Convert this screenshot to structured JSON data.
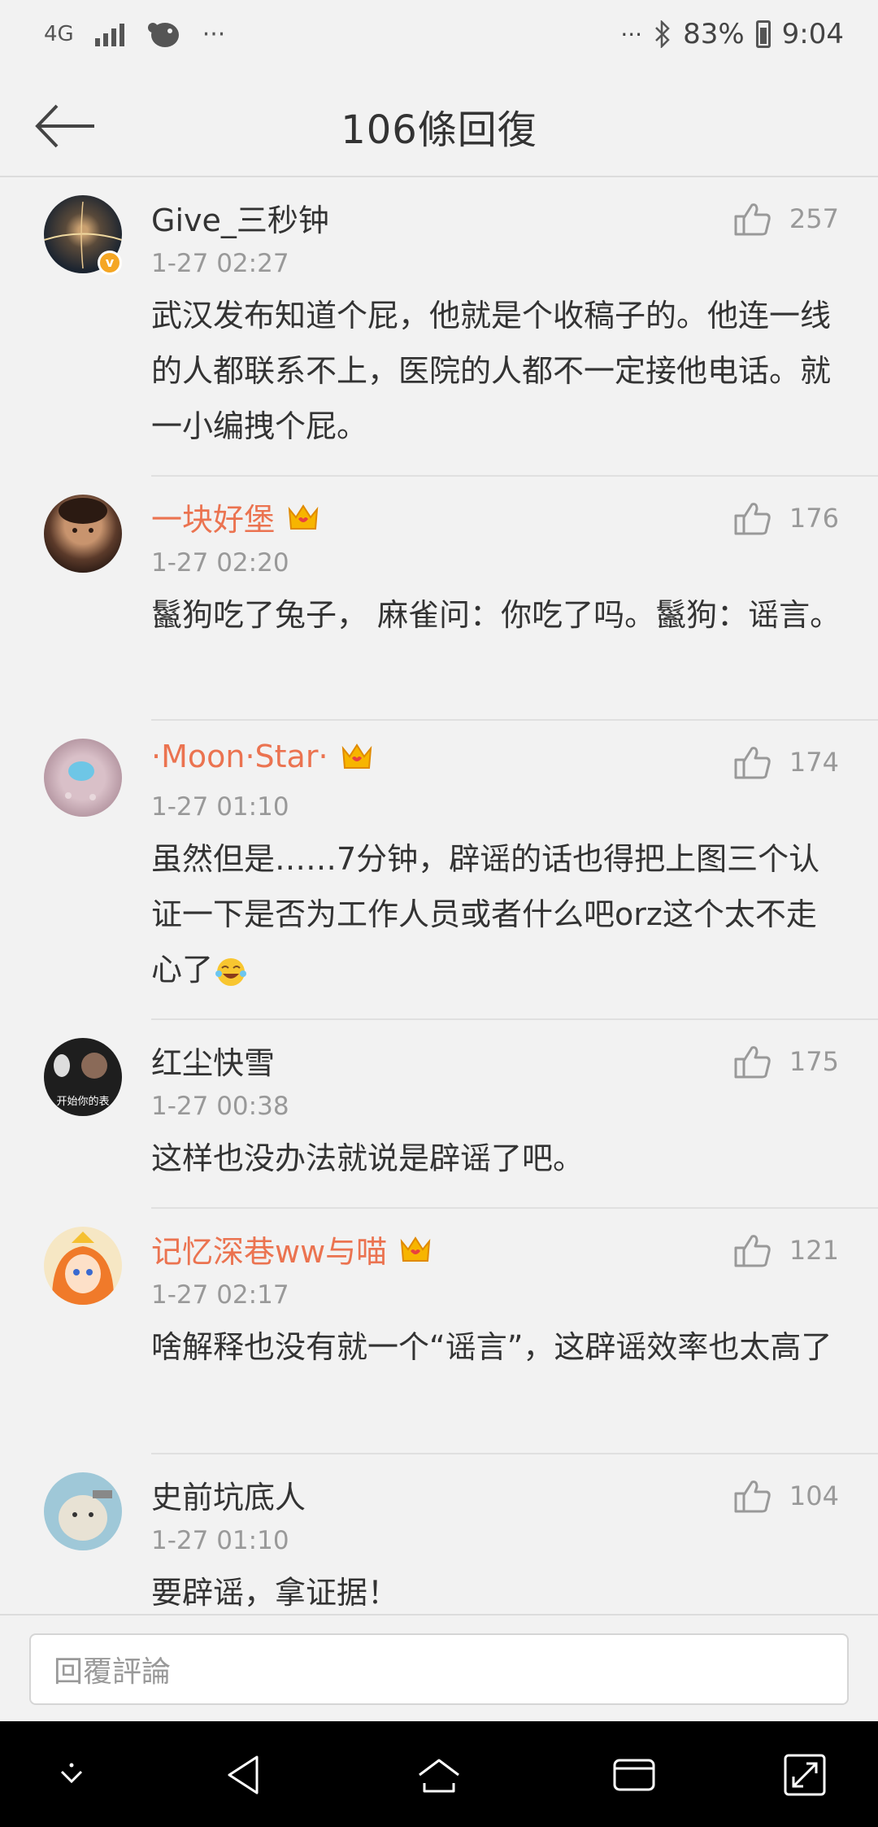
{
  "status_bar": {
    "network": "4G",
    "dots_left": "···",
    "dots_right": "···",
    "battery": "83%",
    "time": "9:04"
  },
  "header": {
    "title": "106條回復",
    "back_icon": "arrow-left-icon"
  },
  "comments": [
    {
      "username": "Give_三秒钟",
      "time": "1-27 02:27",
      "text": "武汉发布知道个屁，他就是个收稿子的。他连一线的人都联系不上，医院的人都不一定接他电话。就一小编拽个屁。",
      "likes": "257",
      "vip": false,
      "verified": true
    },
    {
      "username": "一块好堡",
      "time": "1-27 02:20",
      "text": "鬣狗吃了兔子， 麻雀问：你吃了吗。鬣狗：谣言。",
      "likes": "176",
      "vip": true,
      "verified": false
    },
    {
      "username": "·Moon·Star·",
      "time": "1-27 01:10",
      "text": "虽然但是……7分钟，辟谣的话也得把上图三个认证一下是否为工作人员或者什么吧orz这个太不走心了",
      "likes": "174",
      "vip": true,
      "verified": false
    },
    {
      "username": "红尘快雪",
      "time": "1-27 00:38",
      "text": "这样也没办法就说是辟谣了吧。",
      "likes": "175",
      "vip": false,
      "verified": false
    },
    {
      "username": "记忆深巷ww与喵",
      "time": "1-27 02:17",
      "text": "啥解释也没有就一个“谣言”，这辟谣效率也太高了",
      "likes": "121",
      "vip": true,
      "verified": false
    },
    {
      "username": "史前坑底人",
      "time": "1-27 01:10",
      "text": "要辟谣，拿证据！",
      "likes": "104",
      "vip": false,
      "verified": false
    }
  ],
  "avatar_overlay_text": "开始你的表",
  "reply": {
    "placeholder": "回覆評論"
  },
  "colors": {
    "background": "#f2f2f2",
    "vip_name": "#eb7350",
    "muted": "#999999",
    "system_nav": "#000000"
  }
}
